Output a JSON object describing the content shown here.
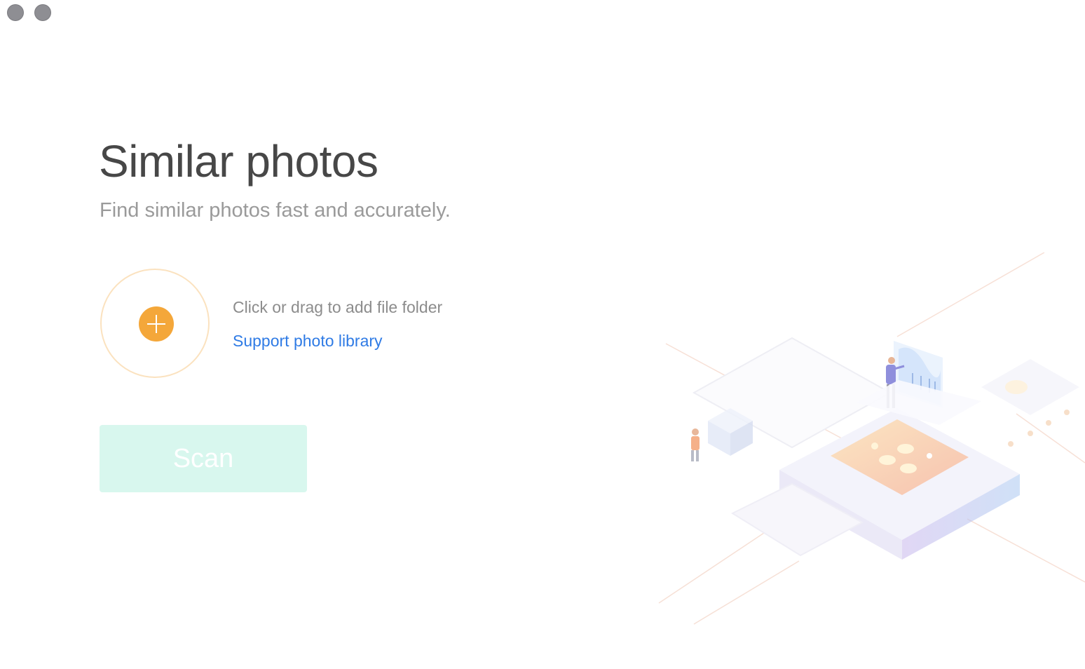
{
  "window": {
    "controls": [
      "close",
      "minimize"
    ]
  },
  "main": {
    "title": "Similar photos",
    "subtitle": "Find similar photos fast and accurately.",
    "add_folder": {
      "hint": "Click or drag to add file folder",
      "link_label": "Support photo library",
      "icon": "plus-icon"
    },
    "scan_label": "Scan",
    "scan_enabled": false
  },
  "colors": {
    "accent_orange": "#f4a73a",
    "ring": "#fbe2bf",
    "link_blue": "#2f7be5",
    "scan_disabled_bg": "#d8f7ee",
    "title": "#474747",
    "subtitle": "#9a9a9a"
  }
}
